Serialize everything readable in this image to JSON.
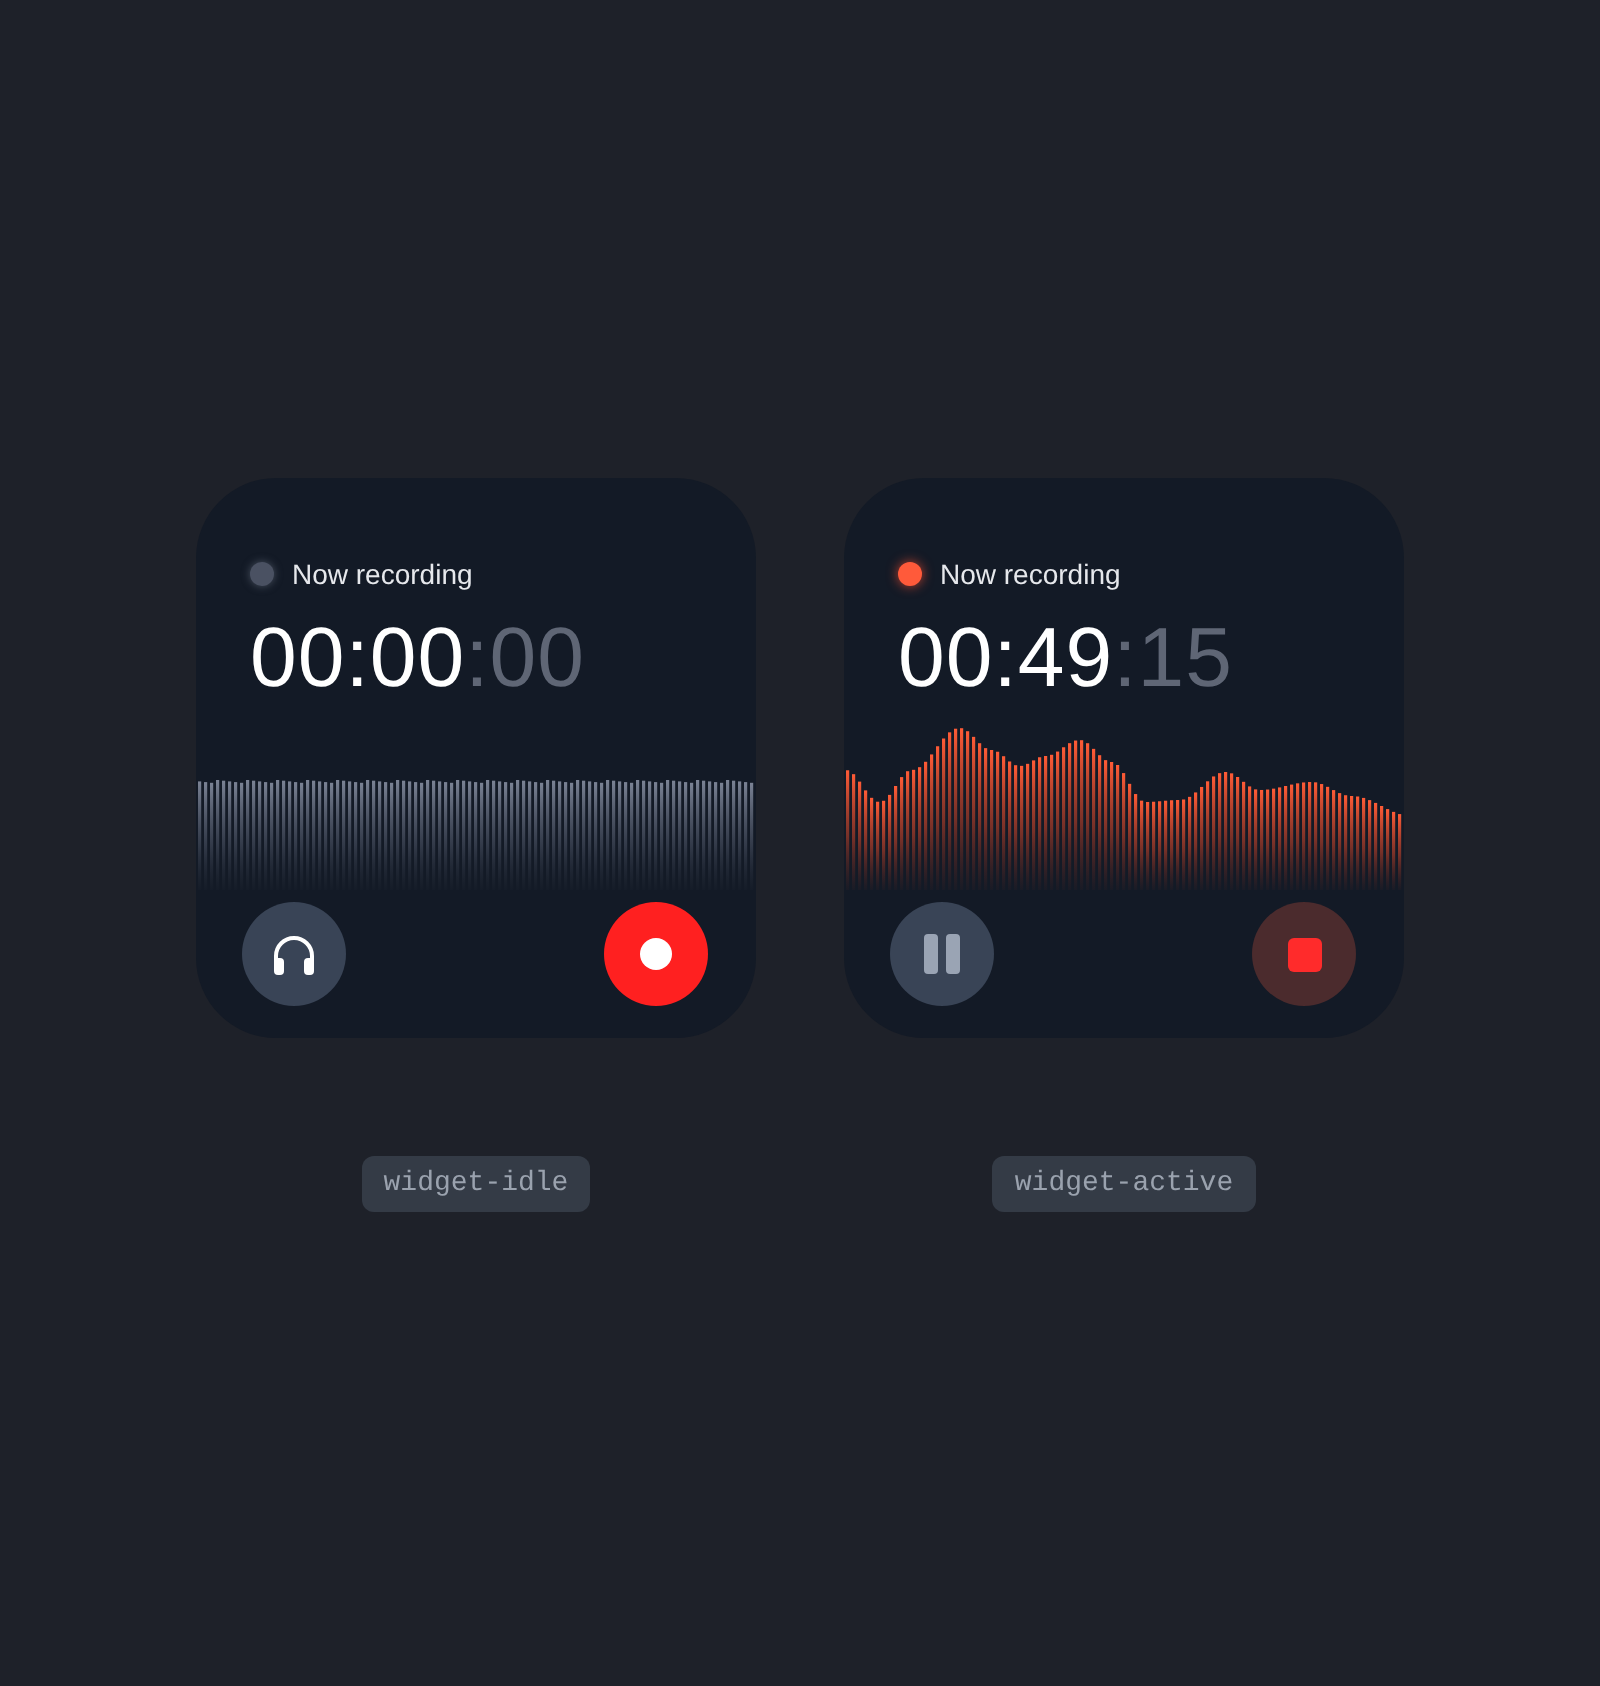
{
  "widgets": [
    {
      "status": "Now recording",
      "recording": false,
      "time": "00:00",
      "time_fraction": ":00",
      "caption": "widget-idle"
    },
    {
      "status": "Now recording",
      "recording": true,
      "time": "00:49",
      "time_fraction": ":15",
      "caption": "widget-active"
    }
  ]
}
